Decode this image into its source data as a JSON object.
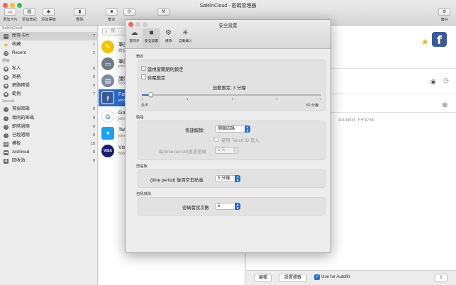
{
  "window": {
    "title": "SafeInCloud - 密碼管理器",
    "toolbar": [
      {
        "label": "添加卡片",
        "icon": "add-card-icon",
        "glyph": "▭"
      },
      {
        "label": "添加筆記",
        "icon": "add-note-icon",
        "glyph": "▤"
      },
      {
        "label": "添加標籤",
        "icon": "add-label-icon",
        "glyph": "◆"
      },
      {
        "label": "刪除",
        "icon": "trash-icon",
        "glyph": "▮"
      },
      {
        "label": "鎖定",
        "icon": "lock-icon",
        "glyph": "■"
      },
      {
        "label": "",
        "icon": "sync-icon",
        "glyph": "⟳"
      },
      {
        "label": "",
        "icon": "tools-icon",
        "glyph": "⚒"
      },
      {
        "label": "偏好",
        "icon": "gear-icon",
        "glyph": "⚙"
      }
    ]
  },
  "sidebar": {
    "header": "SafeInCloud",
    "top_items": [
      {
        "label": "所有卡片",
        "count": "7",
        "icon": "cards-icon",
        "color": "#6d6d6d",
        "selected": true
      },
      {
        "label": "收藏",
        "count": "1",
        "icon": "star-icon",
        "color": "#f0b400"
      },
      {
        "label": "Recent",
        "count": "2",
        "icon": "clock-icon",
        "color": "#6d6d6d"
      }
    ],
    "labels_header": "標籤",
    "label_items": [
      {
        "label": "私人",
        "count": "0",
        "icon": "tag-icon"
      },
      {
        "label": "商務",
        "count": "0",
        "icon": "tag-icon"
      },
      {
        "label": "網路帳號",
        "count": "0",
        "icon": "tag-icon"
      },
      {
        "label": "範例",
        "count": "7",
        "icon": "tag-icon"
      }
    ],
    "special_header": "Special",
    "special_items": [
      {
        "label": "貧弱密碼",
        "count": "0",
        "icon": "warning-icon"
      },
      {
        "label": "相同的密碼",
        "count": "0",
        "icon": "warning-icon"
      },
      {
        "label": "即將過期",
        "count": "0",
        "icon": "warning-icon"
      },
      {
        "label": "已經過期",
        "count": "0",
        "icon": "warning-icon"
      },
      {
        "label": "模板",
        "count": "15",
        "icon": "template-icon"
      },
      {
        "label": "Archived",
        "count": "0",
        "icon": "archive-icon"
      },
      {
        "label": "回收站",
        "count": "0",
        "icon": "trash-icon"
      }
    ]
  },
  "card_list": {
    "search_placeholder": "搜",
    "cards": [
      {
        "title": "筆記",
        "subtitle": "請記",
        "icon": "note-icon",
        "color": "#f2c500",
        "glyph": "✎"
      },
      {
        "title": "筆記",
        "subtitle": "john",
        "icon": "laptop-icon",
        "color": "#6f7a86",
        "glyph": "▭"
      },
      {
        "title": "護照",
        "subtitle": "5555",
        "icon": "passport-icon",
        "color": "#7a8aa0",
        "glyph": "▤"
      },
      {
        "title": "Fac",
        "subtitle": "john",
        "icon": "facebook-icon",
        "color": "#3b5998",
        "glyph": "f",
        "selected": true
      },
      {
        "title": "Goo",
        "subtitle": "john",
        "icon": "google-icon",
        "color": "#ffffff",
        "glyph": "G"
      },
      {
        "title": "Twi",
        "subtitle": "john",
        "icon": "twitter-icon",
        "color": "#1da1f2",
        "glyph": "✦"
      },
      {
        "title": "Vis",
        "subtitle": "5555",
        "icon": "visa-icon",
        "color": "#1a1f71",
        "glyph": "VISA"
      }
    ]
  },
  "detail": {
    "date_text": "2019/8/26 下午12:59",
    "edit_label": "編輯",
    "labels_label": "設置標籤",
    "autofill_label": "Use for Autofill",
    "autofill_checked": true
  },
  "dialog": {
    "title": "安全設置",
    "tabs": [
      {
        "label": "雲同步",
        "icon": "cloud-icon",
        "glyph": "☁"
      },
      {
        "label": "安全設置",
        "icon": "lock-icon",
        "glyph": "■",
        "active": true
      },
      {
        "label": "選項",
        "icon": "gear-icon",
        "glyph": "⚙"
      },
      {
        "label": "自動填入",
        "icon": "wand-icon",
        "glyph": "✳"
      }
    ],
    "lock": {
      "section": "鎖定",
      "lock_on_close_label": "當視窗關閉則鎖定",
      "lock_on_close_checked": false,
      "lock_on_sleep_label": "休眠鎖定",
      "lock_on_sleep_checked": false,
      "autolock_label": "自動鎖定: 3 分鐘",
      "slider_value_fraction": 0.04,
      "slider_min_label": "永不",
      "slider_max_label": "60 分鐘"
    },
    "unlock": {
      "section": "驗證",
      "quick_unlock_label": "快速解鎖：",
      "quick_unlock_value": "開鎖四碼",
      "touch_id_label": "使用 Touch ID 登入",
      "touch_id_checked": false,
      "period_label": "每(time period)要求密碼",
      "period_value": "5 天"
    },
    "clipboard": {
      "section": "剪貼板",
      "clear_label": "(time period) 後清空剪貼板",
      "clear_value": "5 分鐘"
    },
    "self_destruct": {
      "section": "自我抹除",
      "attempts_label": "密碼嘗試次數",
      "attempts_value": "5"
    }
  }
}
